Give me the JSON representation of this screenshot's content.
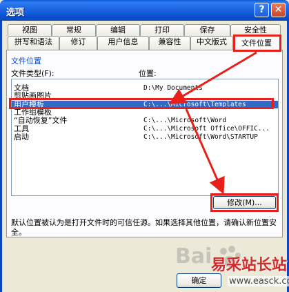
{
  "window": {
    "title": "选项",
    "help_glyph": "?",
    "close_glyph": "✕"
  },
  "tabs": {
    "row1": [
      "视图",
      "常规",
      "编辑",
      "打印",
      "保存",
      "安全性"
    ],
    "row2": [
      "拼写和语法",
      "修订",
      "用户信息",
      "兼容性",
      "中文版式",
      "文件位置"
    ],
    "selected": "文件位置"
  },
  "file_locations": {
    "group_title": "文件位置",
    "col_type": "文件类型(F):",
    "col_location": "位置:",
    "rows": [
      {
        "name": "文档",
        "location": "D:\\My Documents"
      },
      {
        "name": "剪贴画图片",
        "location": ""
      },
      {
        "name": "用户模板",
        "location": "C:\\...\\Microsoft\\Templates"
      },
      {
        "name": "工作组模板",
        "location": ""
      },
      {
        "name": "“自动恢复”文件",
        "location": "C:\\...\\Microsoft\\Word"
      },
      {
        "name": "工具",
        "location": "C:\\...\\Microsoft Office\\OFFIC..."
      },
      {
        "name": "启动",
        "location": "C:\\...\\Microsoft\\Word\\STARTUP"
      }
    ],
    "selected_row": "用户模板",
    "modify_button": "修改(M)...",
    "description": "默认位置被认为是打开文件时的可信任源。如果选择其他位置，请确认新位置安全。"
  },
  "footer": {
    "ok_button": "确定"
  },
  "watermark": {
    "brand": "Bai",
    "site_name": "易采站长站",
    "url": "www.easck.com"
  },
  "colors": {
    "highlight": "#316ac5",
    "annotation_red": "#e8201a",
    "title_blue": "#0a52d0"
  }
}
